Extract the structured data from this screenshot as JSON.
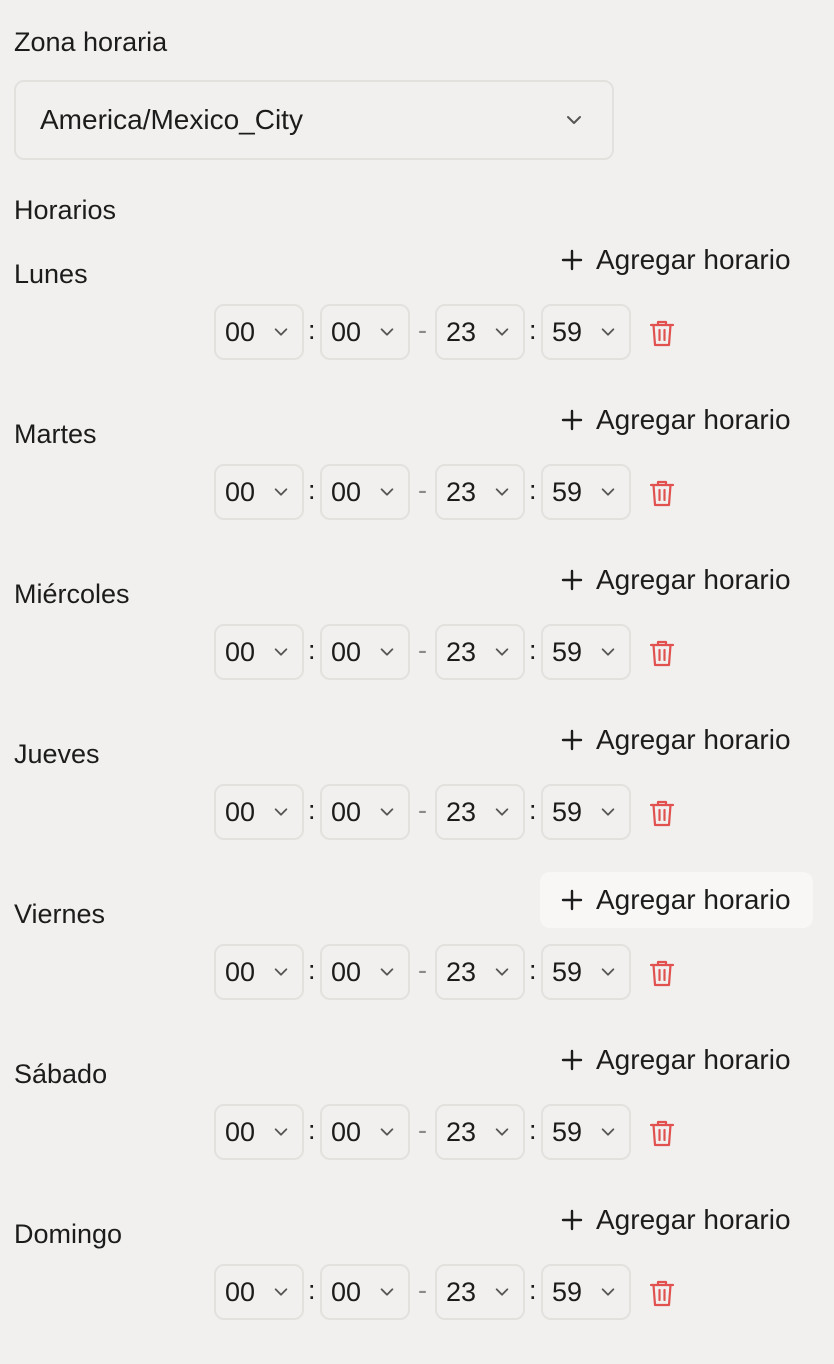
{
  "timezone": {
    "label": "Zona horaria",
    "value": "America/Mexico_City"
  },
  "schedules_label": "Horarios",
  "add_label": "Agregar horario",
  "days": [
    {
      "name": "Lunes",
      "start_h": "00",
      "start_m": "00",
      "end_h": "23",
      "end_m": "59"
    },
    {
      "name": "Martes",
      "start_h": "00",
      "start_m": "00",
      "end_h": "23",
      "end_m": "59"
    },
    {
      "name": "Miércoles",
      "start_h": "00",
      "start_m": "00",
      "end_h": "23",
      "end_m": "59"
    },
    {
      "name": "Jueves",
      "start_h": "00",
      "start_m": "00",
      "end_h": "23",
      "end_m": "59"
    },
    {
      "name": "Viernes",
      "start_h": "00",
      "start_m": "00",
      "end_h": "23",
      "end_m": "59"
    },
    {
      "name": "Sábado",
      "start_h": "00",
      "start_m": "00",
      "end_h": "23",
      "end_m": "59"
    },
    {
      "name": "Domingo",
      "start_h": "00",
      "start_m": "00",
      "end_h": "23",
      "end_m": "59"
    }
  ],
  "separators": {
    "colon": ":",
    "dash": "-"
  },
  "colors": {
    "background": "#f1f0ee",
    "border": "#e3e1de",
    "delete": "#e0514f",
    "hover_button": "#f8f7f6"
  },
  "icons": {
    "dropdown": "chevron-down-icon",
    "add": "plus-icon",
    "delete": "trash-icon"
  }
}
